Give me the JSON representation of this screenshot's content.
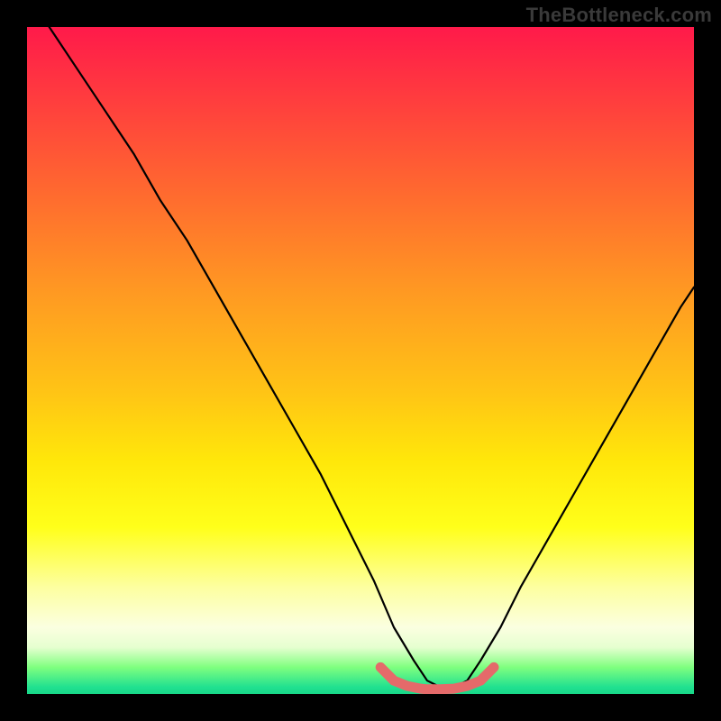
{
  "watermark": "TheBottleneck.com",
  "colors": {
    "background": "#000000",
    "curve": "#000000",
    "accent": "#e56a6a",
    "gradient_stops": [
      "#ff1a4a",
      "#ff3a3f",
      "#ff6a2f",
      "#ff9a22",
      "#ffc515",
      "#ffe70a",
      "#ffff1a",
      "#fdffa0",
      "#fbffe0",
      "#e6ffd0",
      "#7fff7f",
      "#20e090",
      "#18d888"
    ]
  },
  "chart_data": {
    "type": "line",
    "title": "",
    "xlabel": "",
    "ylabel": "",
    "xlim": [
      0,
      100
    ],
    "ylim": [
      0,
      100
    ],
    "series": [
      {
        "name": "bottleneck-curve",
        "x": [
          0,
          4,
          8,
          12,
          16,
          20,
          24,
          28,
          32,
          36,
          40,
          44,
          48,
          52,
          55,
          58,
          60,
          62,
          64,
          66,
          68,
          71,
          74,
          78,
          82,
          86,
          90,
          94,
          98,
          100
        ],
        "values": [
          105,
          99,
          93,
          87,
          81,
          74,
          68,
          61,
          54,
          47,
          40,
          33,
          25,
          17,
          10,
          5,
          2,
          1,
          1,
          2,
          5,
          10,
          16,
          23,
          30,
          37,
          44,
          51,
          58,
          61
        ]
      }
    ],
    "accent_region": {
      "name": "sweet-spot",
      "x": [
        53,
        55,
        57,
        59,
        60,
        62,
        64,
        66,
        68,
        70
      ],
      "values": [
        4,
        2,
        1.2,
        0.8,
        0.7,
        0.7,
        0.8,
        1.2,
        2,
        4
      ]
    }
  }
}
